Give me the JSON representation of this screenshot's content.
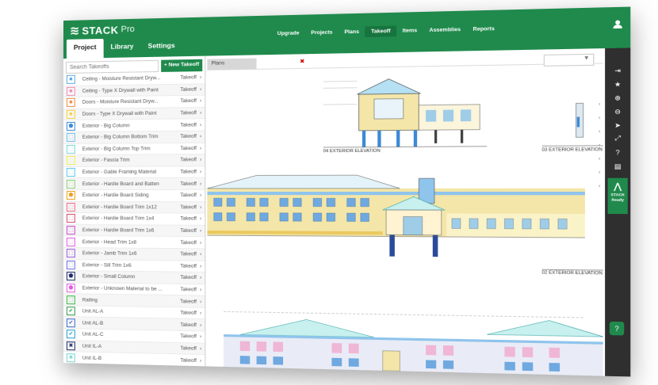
{
  "app": {
    "brand": "STACK",
    "edition": "Pro"
  },
  "subtabs": [
    "Project",
    "Library",
    "Settings"
  ],
  "nav": [
    "Upgrade",
    "Projects",
    "Plans",
    "Takeoff",
    "Items",
    "Assemblies",
    "Reports"
  ],
  "search": {
    "placeholder": "Search Takeoffs"
  },
  "new_takeoff_label": "+ New Takeoff",
  "takeoffs": [
    {
      "name": "Ceiling - Moisture Resistant Dryw...",
      "action": "Takeoff",
      "color": "#5ba8e8",
      "symbol": "■"
    },
    {
      "name": "Ceiling - Type X Drywall with Paint",
      "action": "Takeoff",
      "color": "#f28cb4",
      "symbol": "■"
    },
    {
      "name": "Doors - Moisture Resistant Dryw...",
      "action": "Takeoff",
      "color": "#f08a3c",
      "symbol": "■"
    },
    {
      "name": "Doors - Type X Drywall with Paint",
      "action": "Takeoff",
      "color": "#f5d13a",
      "symbol": "■"
    },
    {
      "name": "Exterior - Big Column",
      "action": "Takeoff",
      "color": "#3d8ad6",
      "symbol": "⬟"
    },
    {
      "name": "Exterior - Big Column Bottom Trim",
      "action": "Takeoff",
      "color": "#6fc2e8",
      "symbol": "⬚"
    },
    {
      "name": "Exterior - Big Column Top Trim",
      "action": "Takeoff",
      "color": "#7ad6d1",
      "symbol": "⬚"
    },
    {
      "name": "Exterior - Fascia Trim",
      "action": "Takeoff",
      "color": "#f0ee5a",
      "symbol": "⬚"
    },
    {
      "name": "Exterior - Gable Framing Material",
      "action": "Takeoff",
      "color": "#5ec7e8",
      "symbol": "⬚"
    },
    {
      "name": "Exterior - Hardie Board and Batten",
      "action": "Takeoff",
      "color": "#8fd17a",
      "symbol": "⬚"
    },
    {
      "name": "Exterior - Hardie Board Siding",
      "action": "Takeoff",
      "color": "#f0a020",
      "symbol": "⬟"
    },
    {
      "name": "Exterior - Hardie Board Trim 1x12",
      "action": "Takeoff",
      "color": "#f06a8a",
      "symbol": "⬚"
    },
    {
      "name": "Exterior - Hardie Board Trim 1x4",
      "action": "Takeoff",
      "color": "#d84a6a",
      "symbol": "⬚"
    },
    {
      "name": "Exterior - Hardie Board Trim 1x6",
      "action": "Takeoff",
      "color": "#c94ac9",
      "symbol": "⬚"
    },
    {
      "name": "Exterior - Head Trim 1x8",
      "action": "Takeoff",
      "color": "#e05ae0",
      "symbol": "⬚"
    },
    {
      "name": "Exterior - Jamb Trim 1x6",
      "action": "Takeoff",
      "color": "#9a5ae0",
      "symbol": "⬚"
    },
    {
      "name": "Exterior - Sill Trim 1x6",
      "action": "Takeoff",
      "color": "#6a6ae0",
      "symbol": "⬚"
    },
    {
      "name": "Exterior - Small Column",
      "action": "Takeoff",
      "color": "#1e2a6a",
      "symbol": "⬟"
    },
    {
      "name": "Exterior - Unknown Material to be ...",
      "action": "Takeoff",
      "color": "#e05ae0",
      "symbol": "⬟"
    },
    {
      "name": "Railing",
      "action": "Takeoff",
      "color": "#3ab84a",
      "symbol": "⬚"
    },
    {
      "name": "Unit AL-A",
      "action": "Takeoff",
      "color": "#2e9a4a",
      "symbol": "✔"
    },
    {
      "name": "Unit AL-B",
      "action": "Takeoff",
      "color": "#3a6ad6",
      "symbol": "✔"
    },
    {
      "name": "Unit AL-C",
      "action": "Takeoff",
      "color": "#20a0d0",
      "symbol": "✔"
    },
    {
      "name": "Unit IL-A",
      "action": "Takeoff",
      "color": "#1e2a6a",
      "symbol": "✖"
    },
    {
      "name": "Unit IL-B",
      "action": "Takeoff",
      "color": "#7ad6d1",
      "symbol": "✖"
    }
  ],
  "plan_tab": {
    "label": "Plans",
    "close": "✖"
  },
  "plan_select_arrow": "▼",
  "elevation_labels": [
    "04 EXTERIOR ELEVATION",
    "03 EXTERIOR ELEVATION",
    "02 EXTERIOR ELEVATION"
  ],
  "tools": [
    "user-icon",
    "exit-icon",
    "star-icon",
    "zoom-in-icon",
    "zoom-out-icon",
    "pointer-icon",
    "expand-icon",
    "help-icon",
    "document-icon"
  ],
  "tool_glyphs": [
    "⇥",
    "★",
    "⊕",
    "⊖",
    "➤",
    "⤢",
    "?",
    "▤"
  ],
  "stack_ready": {
    "line1": "STACK",
    "line2": "Ready"
  },
  "help_glyph": "?"
}
